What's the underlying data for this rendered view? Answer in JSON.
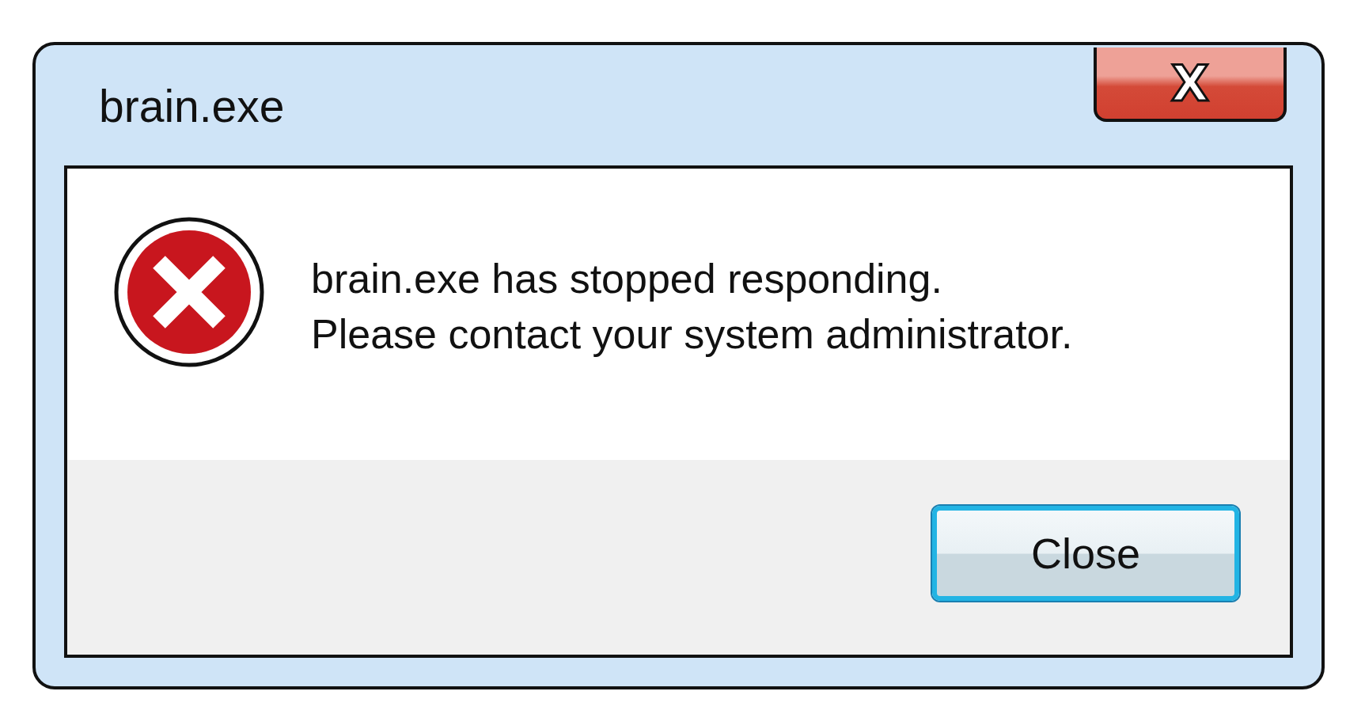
{
  "window": {
    "title": "brain.exe",
    "close_glyph": "X"
  },
  "message": {
    "lines": [
      "brain.exe has stopped responding.",
      "Please contact your system administrator."
    ]
  },
  "buttons": [
    {
      "label": "Close",
      "focused": true
    }
  ]
}
